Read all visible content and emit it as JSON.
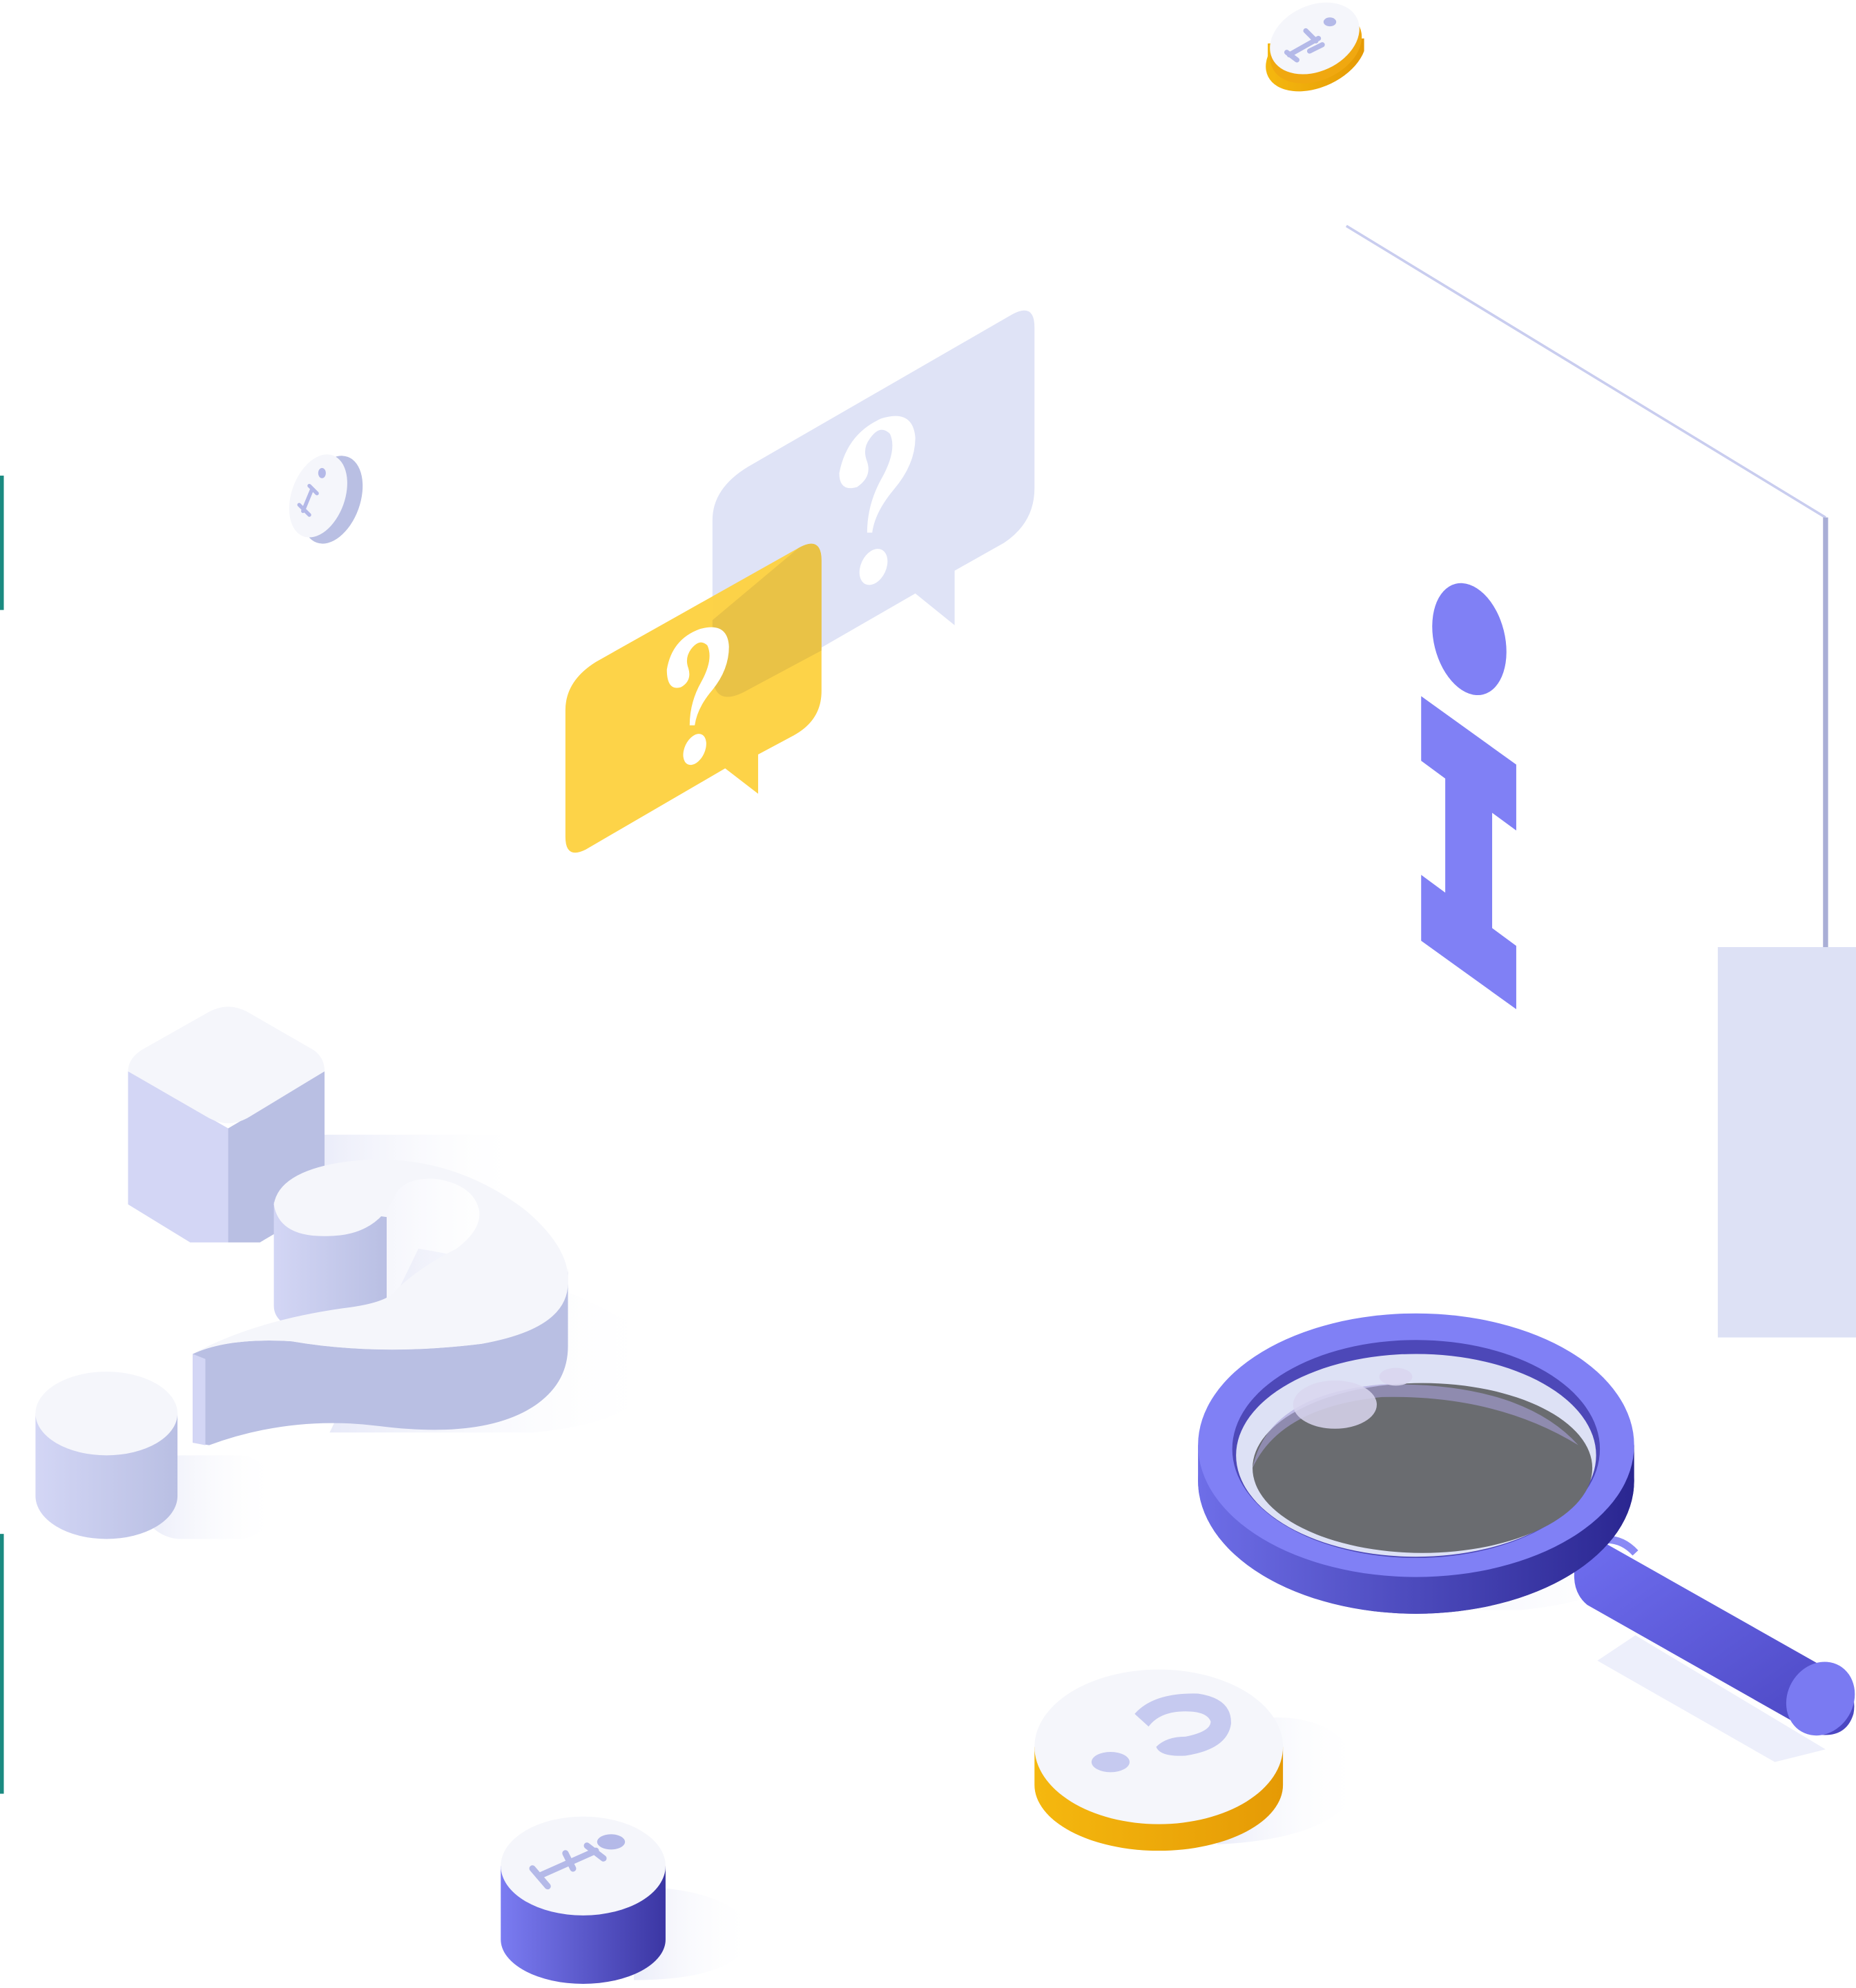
{
  "colors": {
    "background": "#ffffff",
    "accent_purple": "#8080f5",
    "deep_purple": "#3f3aa6",
    "lavender": "#dde1f5",
    "lavender_shade": "#b9bfe3",
    "light_face": "#f5f6fb",
    "yellow": "#fdd13e",
    "orange": "#f0a810",
    "lens_gray": "#6a6c70",
    "teal_edge": "#1a8a80"
  },
  "icons": [
    "info-coin-icon",
    "question-bubble-icon",
    "info-i-icon",
    "question-mark-3d-icon",
    "cube-icon",
    "cylinder-icon",
    "magnifying-glass-icon",
    "question-coin-icon"
  ]
}
